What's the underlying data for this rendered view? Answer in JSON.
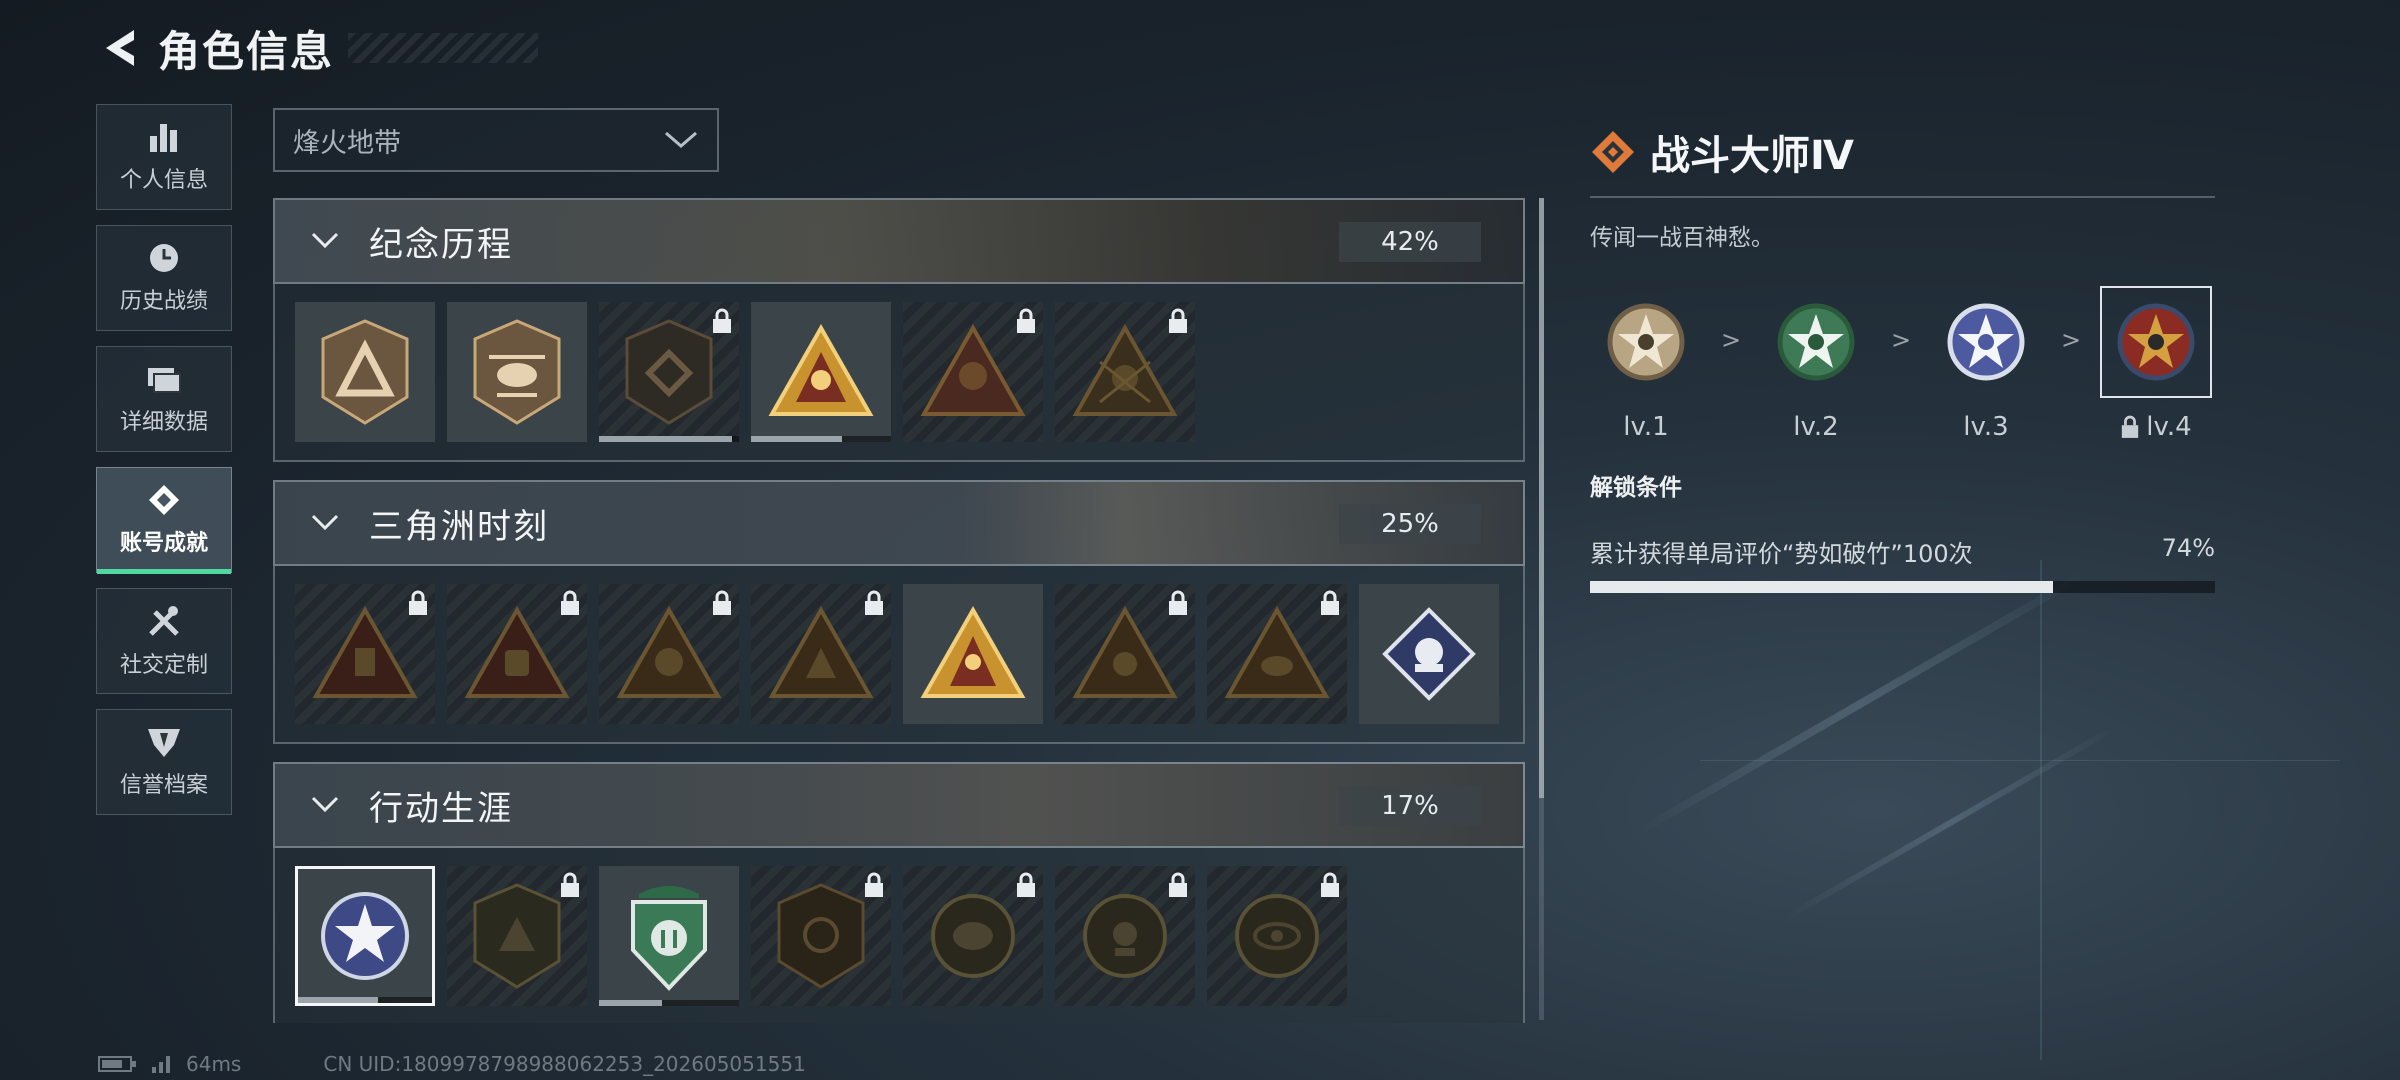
{
  "header": {
    "title": "角色信息"
  },
  "sidebar": {
    "items": [
      {
        "label": "个人信息",
        "icon": "bar-chart-icon"
      },
      {
        "label": "历史战绩",
        "icon": "clock-icon"
      },
      {
        "label": "详细数据",
        "icon": "folders-icon"
      },
      {
        "label": "账号成就",
        "icon": "achievement-icon",
        "active": true
      },
      {
        "label": "社交定制",
        "icon": "tools-icon"
      },
      {
        "label": "信誉档案",
        "icon": "shield-icon"
      }
    ]
  },
  "mode_select": {
    "value": "烽火地带"
  },
  "sections": [
    {
      "name": "纪念历程",
      "percent": "42%",
      "badges": 6,
      "locked": [
        2,
        4,
        5
      ],
      "progress": {
        "2": 0.95,
        "3": 0.65
      }
    },
    {
      "name": "三角洲时刻",
      "percent": "25%",
      "badges": 8,
      "locked": [
        0,
        1,
        2,
        3,
        5,
        6
      ]
    },
    {
      "name": "行动生涯",
      "percent": "17%",
      "badges": 7,
      "locked": [
        1,
        3,
        4,
        5,
        6
      ],
      "selected": 0,
      "progress": {
        "0": 0.6,
        "2": 0.45
      }
    }
  ],
  "detail": {
    "title": "战斗大师Ⅳ",
    "description": "传闻一战百神愁。",
    "levels": [
      "lv.1",
      "lv.2",
      "lv.3",
      "lv.4"
    ],
    "level_separator": ">",
    "unlock_title": "解锁条件",
    "condition": "累计获得单局评价“势如破竹”100次",
    "condition_percent": "74%",
    "condition_progress": 0.74
  },
  "footer": {
    "ping": "64ms",
    "uid": "CN UID:1809978798988062253_202605051551"
  },
  "colors": {
    "accent": "#4fd8a0",
    "title_icon": "#e07a3a"
  }
}
